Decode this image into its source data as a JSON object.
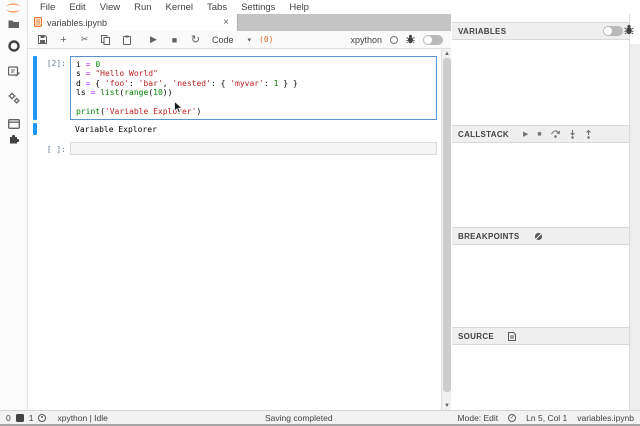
{
  "menu": {
    "items": [
      "File",
      "Edit",
      "View",
      "Run",
      "Kernel",
      "Tabs",
      "Settings",
      "Help"
    ]
  },
  "left_sidebar": {
    "icons": [
      "jupyter-logo",
      "file-browser-icon",
      "running-sessions-icon",
      "property-inspector-icon",
      "settings-gears-icon",
      "open-tabs-icon",
      "extension-manager-icon"
    ]
  },
  "tab": {
    "title": "variables.ipynb",
    "close_label": "×",
    "icon": "notebook-icon"
  },
  "toolbar": {
    "buttons": [
      "save-icon",
      "add-cell-icon",
      "cut-cell-icon",
      "copy-cell-icon",
      "paste-cell-icon",
      "run-icon",
      "stop-icon",
      "restart-kernel-icon"
    ],
    "run_glyph": "▶",
    "stop_glyph": "■",
    "restart_glyph": "↻",
    "add_glyph": "+",
    "cut_glyph": "✂",
    "cell_type": "Code",
    "chevron": "▾",
    "badge": "(0)",
    "kernel_name": "xpython",
    "kernel_status_icon": "kernel-idle-circle",
    "debugger_icon": "bug-icon",
    "debug_toggle": "off"
  },
  "notebook": {
    "cells": [
      {
        "prompt": "[2]:",
        "code_lines": [
          [
            [
              "nm",
              "i"
            ],
            [
              "pl",
              " "
            ],
            [
              "op",
              "="
            ],
            [
              "pl",
              " "
            ],
            [
              "num",
              "0"
            ]
          ],
          [
            [
              "nm",
              "s"
            ],
            [
              "pl",
              " "
            ],
            [
              "op",
              "="
            ],
            [
              "pl",
              " "
            ],
            [
              "str",
              "\"Hello World\""
            ]
          ],
          [
            [
              "nm",
              "d"
            ],
            [
              "pl",
              " "
            ],
            [
              "op",
              "="
            ],
            [
              "pl",
              " { "
            ],
            [
              "str",
              "'foo'"
            ],
            [
              "pl",
              ": "
            ],
            [
              "str",
              "'bar'"
            ],
            [
              "pl",
              ", "
            ],
            [
              "str",
              "'nested'"
            ],
            [
              "pl",
              ": { "
            ],
            [
              "str",
              "'myvar'"
            ],
            [
              "pl",
              ": "
            ],
            [
              "num",
              "1"
            ],
            [
              "pl",
              " } }"
            ]
          ],
          [
            [
              "nm",
              "ls"
            ],
            [
              "pl",
              " "
            ],
            [
              "op",
              "="
            ],
            [
              "pl",
              " "
            ],
            [
              "bi",
              "list"
            ],
            [
              "pl",
              "("
            ],
            [
              "bi",
              "range"
            ],
            [
              "pl",
              "("
            ],
            [
              "num",
              "10"
            ],
            [
              "pl",
              "))"
            ]
          ],
          [],
          [
            [
              "bi",
              "print"
            ],
            [
              "pl",
              "("
            ],
            [
              "str",
              "'Variable Explorer'"
            ],
            [
              "pl",
              ")"
            ]
          ]
        ],
        "output": "Variable Explorer"
      },
      {
        "prompt": "[ ]:",
        "code_lines": [],
        "output": ""
      }
    ],
    "scrollbar": {
      "up_glyph": "▲",
      "down_glyph": "▼"
    }
  },
  "debugger_sidebar": {
    "variables": {
      "title": "VARIABLES",
      "toggle": "off"
    },
    "callstack": {
      "title": "CALLSTACK",
      "icons": [
        "continue-icon",
        "terminate-icon",
        "step-over-icon",
        "step-in-icon",
        "step-out-icon"
      ],
      "continue_glyph": "▶",
      "terminate_glyph": "■"
    },
    "breakpoints": {
      "title": "BREAKPOINTS",
      "icons": [
        "remove-all-breakpoints-icon"
      ]
    },
    "source": {
      "title": "SOURCE",
      "icons": [
        "open-source-icon"
      ]
    }
  },
  "right_strip": {
    "icons": [
      "debugger-tab-bug-icon"
    ]
  },
  "statusbar": {
    "terminals_count": "0",
    "kernels_count": "1",
    "kernel_status": "xpython | Idle",
    "saving": "Saving completed",
    "mode": "Mode: Edit",
    "check_glyph": "✓",
    "position": "Ln 5, Col 1",
    "filename": "variables.ipynb"
  },
  "colors": {
    "jupyter_orange": "#f37626",
    "collapser_blue": "#2196f3",
    "cell_border_blue": "#5795cc",
    "syntax_operator": "#aa22ff",
    "syntax_number": "#008000",
    "syntax_string": "#ba2121",
    "syntax_builtin": "#008000",
    "prompt_color": "#6c8399",
    "badge_orange": "#e46e2e"
  }
}
